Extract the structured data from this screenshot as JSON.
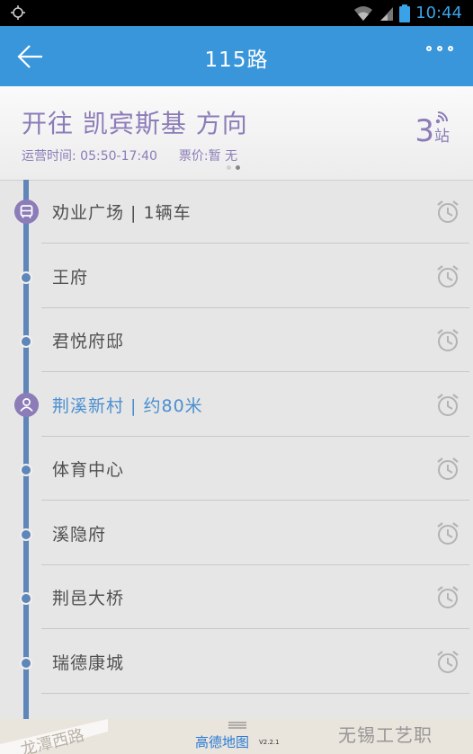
{
  "status_bar": {
    "time": "10:44"
  },
  "app_bar": {
    "title": "115路"
  },
  "header": {
    "direction": "开往 凯宾斯基 方向",
    "hours": "运营时间: 05:50-17:40",
    "fare": "票价:暂 无",
    "stops_count": "3",
    "stops_unit": "站",
    "page_total": 2,
    "page_current": 2
  },
  "stations": [
    {
      "name": "劝业广场 | 1辆车",
      "type": "bus"
    },
    {
      "name": "王府",
      "type": "stop"
    },
    {
      "name": "君悦府邸",
      "type": "stop"
    },
    {
      "name": "荆溪新村 | 约80米",
      "type": "user",
      "highlight": true
    },
    {
      "name": "体育中心",
      "type": "stop"
    },
    {
      "name": "溪隐府",
      "type": "stop"
    },
    {
      "name": "荆邑大桥",
      "type": "stop"
    },
    {
      "name": "瑞德康城",
      "type": "stop"
    }
  ],
  "map": {
    "road_label": "龙潭西路",
    "poi_label": "无锡工艺职",
    "brand": "高德地图",
    "version": "V2.2.1"
  },
  "colors": {
    "accent": "#3a96da",
    "route": "#5f86b8",
    "purple": "#8c7cb8"
  }
}
